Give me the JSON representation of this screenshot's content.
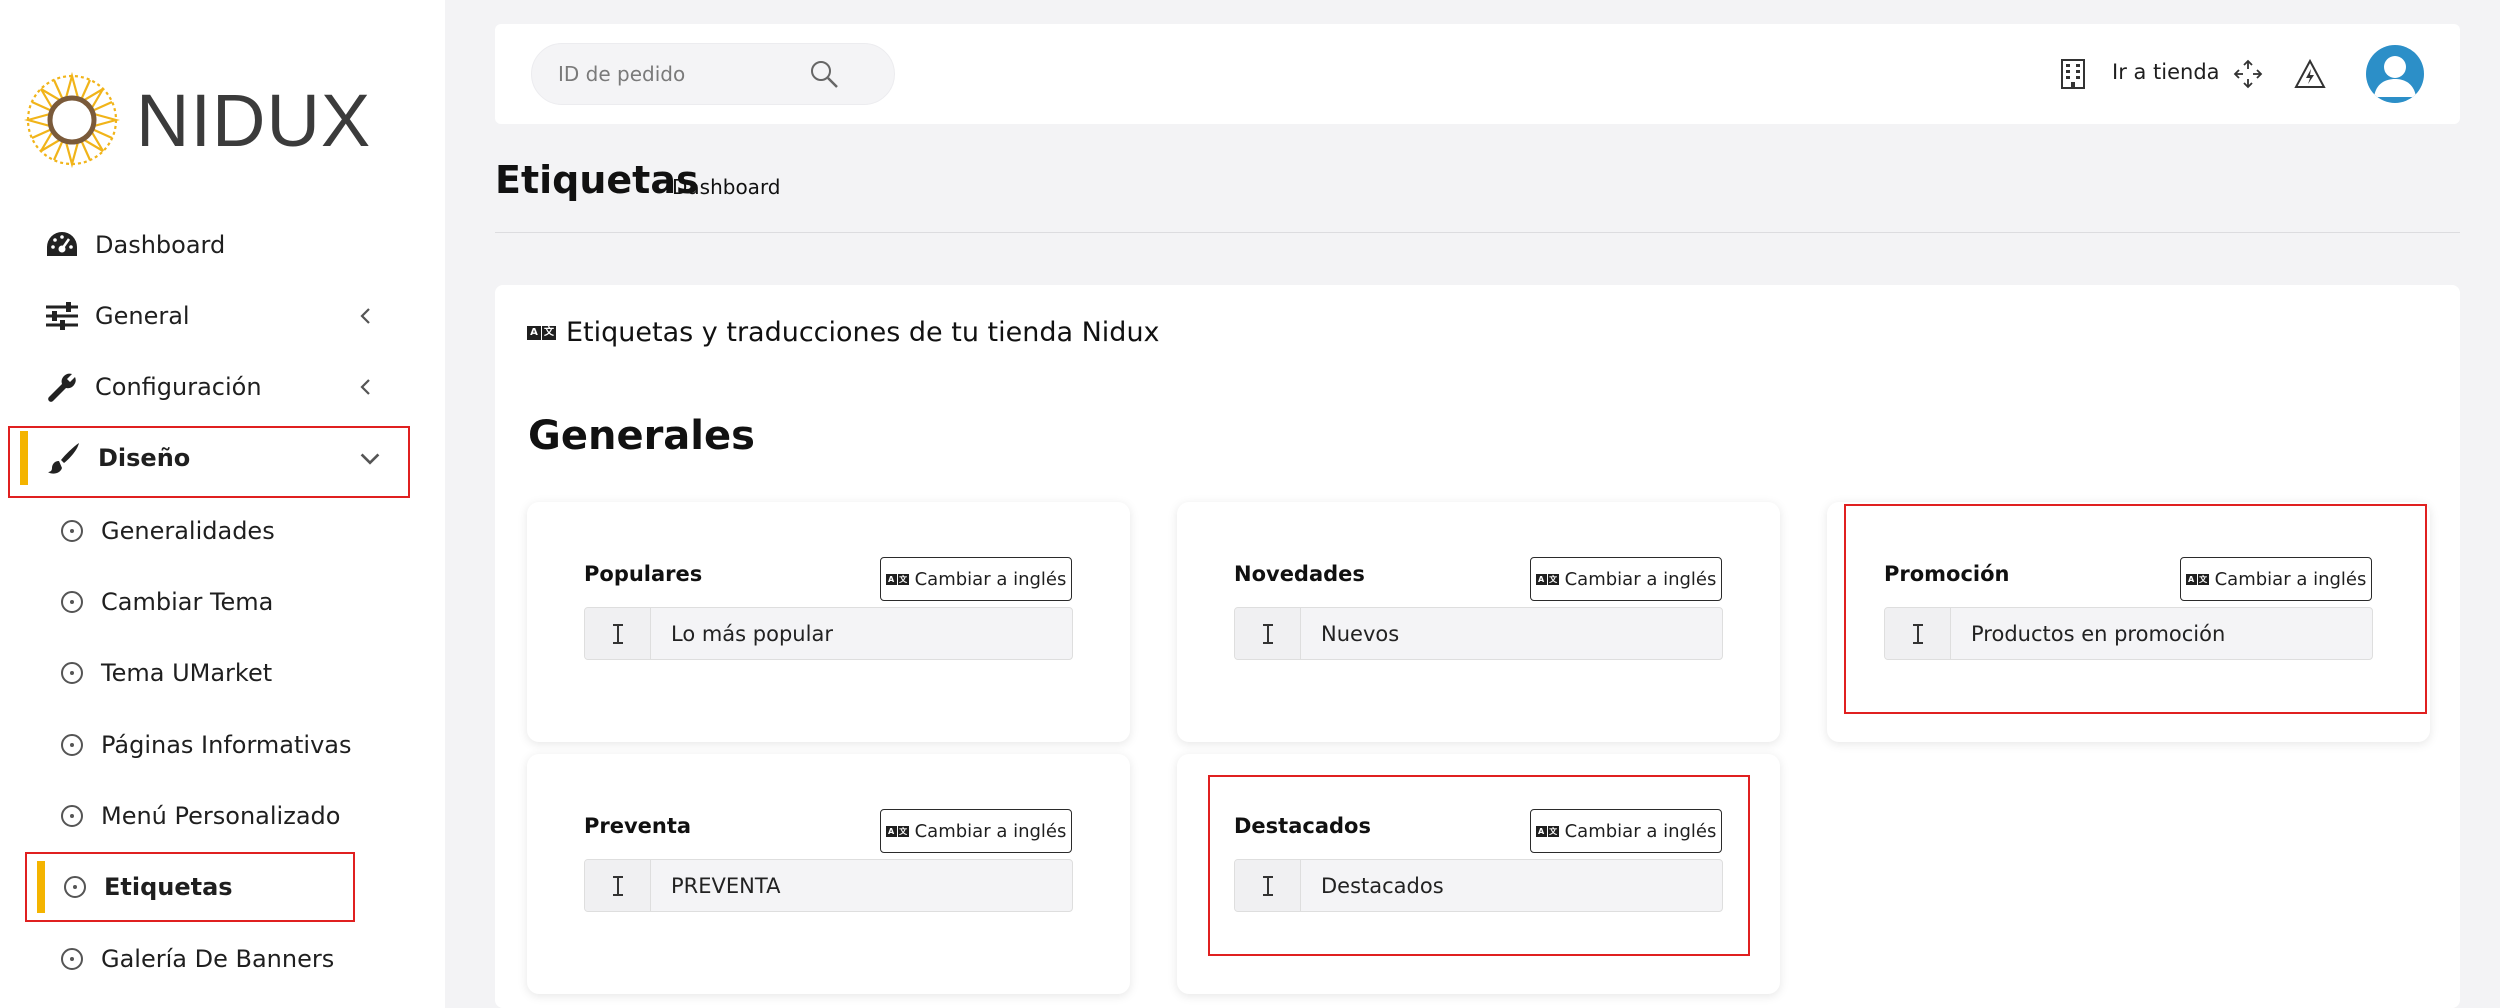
{
  "brand": {
    "logo_text": "NIDUX",
    "accent_color": "#f4b400"
  },
  "sidebar": {
    "items": [
      {
        "label": "Dashboard",
        "icon": "speedometer-icon"
      },
      {
        "label": "General",
        "icon": "sliders-icon"
      },
      {
        "label": "Configuración",
        "icon": "wrench-icon"
      },
      {
        "label": "Diseño",
        "icon": "paintbrush-icon",
        "expanded": true
      }
    ],
    "sub_items": [
      {
        "label": "Generalidades"
      },
      {
        "label": "Cambiar Tema"
      },
      {
        "label": "Tema UMarket"
      },
      {
        "label": "Páginas Informativas"
      },
      {
        "label": "Menú Personalizado"
      },
      {
        "label": "Etiquetas",
        "active": true
      },
      {
        "label": "Galería De Banners"
      }
    ]
  },
  "topbar": {
    "search_placeholder": "ID de pedido",
    "store_link": "Ir a tienda"
  },
  "page": {
    "title": "Etiquetas",
    "breadcrumb": "Dashboard"
  },
  "main": {
    "card_title": "Etiquetas y traducciones de tu tienda Nidux",
    "section_title": "Generales",
    "translate_button_label": "Cambiar a inglés",
    "labels": [
      {
        "title": "Populares",
        "value": "Lo más popular"
      },
      {
        "title": "Novedades",
        "value": "Nuevos"
      },
      {
        "title": "Promoción",
        "value": "Productos en promoción"
      },
      {
        "title": "Preventa",
        "value": "PREVENTA"
      },
      {
        "title": "Destacados",
        "value": "Destacados"
      }
    ]
  },
  "highlight_color": "#e02020",
  "avatar_color": "#2c8fc8"
}
